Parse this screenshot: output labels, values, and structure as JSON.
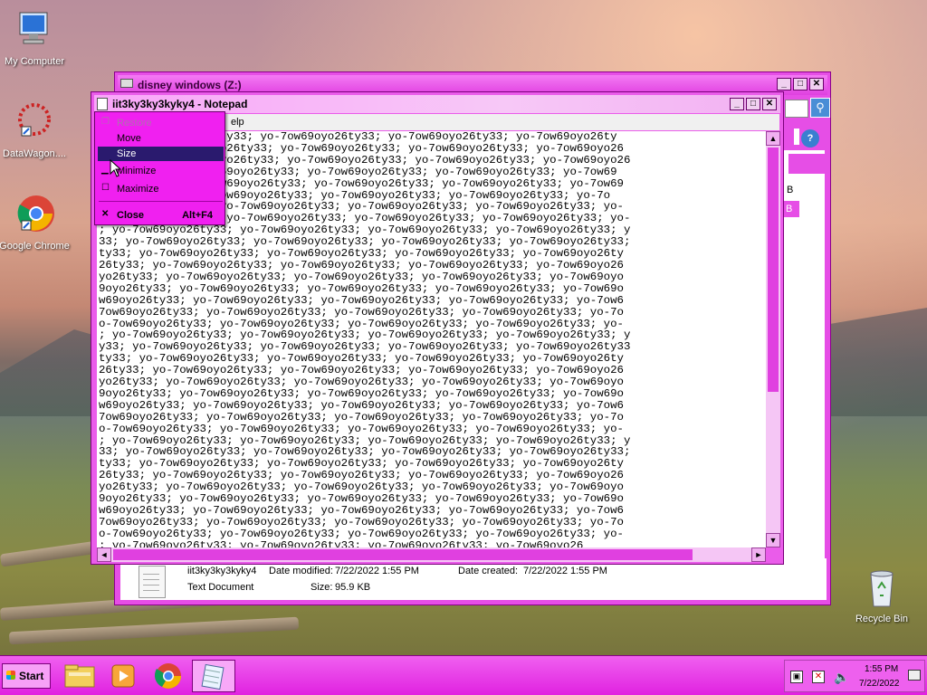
{
  "desktop": {
    "icons": [
      {
        "label": "My Computer",
        "icon": "computer-icon"
      },
      {
        "label": "DataWagon....",
        "icon": "datawagon-shortcut-icon"
      },
      {
        "label": "Google Chrome",
        "icon": "chrome-shortcut-icon"
      },
      {
        "label": "Recycle Bin",
        "icon": "recycle-bin-icon"
      }
    ]
  },
  "explorer": {
    "title": "disney windows (Z:)",
    "details": {
      "name": "iit3ky3ky3kyky4",
      "modified_label": "Date modified:",
      "modified_value": "7/22/2022 1:55 PM",
      "created_label": "Date created:",
      "created_value": "7/22/2022 1:55 PM",
      "type": "Text Document",
      "size_label": "Size:",
      "size_value": "95.9 KB"
    },
    "partial_b1": "B",
    "partial_b2": "B"
  },
  "notepad": {
    "title": "iit3ky3ky3kyky4 - Notepad",
    "menu_partial": "elp",
    "last_line": "; yo-7ow69oyo26ty33; yo-7ow69oyo26ty33; yo-7ow69oyo26ty33; yo-7ow69oyo26",
    "lines": [
      "y33; yo-7ow69oyo26ty33; yo-7ow69oyo26ty33; yo-7ow69oyo26ty33; yo-7ow69oyo26ty",
      "26ty33; yo-7ow69oyo26ty33; yo-7ow69oyo26ty33; yo-7ow69oyo26ty33; yo-7ow69oyo26",
      "o26ty33; yo-7ow69oyo26ty33; yo-7ow69oyo26ty33; yo-7ow69oyo26ty33; yo-7ow69oyo26",
      "9oyo26ty33; yo-7ow69oyo26ty33; yo-7ow69oyo26ty33; yo-7ow69oyo26ty33; yo-7ow69",
      "69oyo26ty33; yo-7ow69oyo26ty33; yo-7ow69oyo26ty33; yo-7ow69oyo26ty33; yo-7ow69",
      "w69oyo26ty33; yo-7ow69oyo26ty33; yo-7ow69oyo26ty33; yo-7ow69oyo26ty33; yo-7o",
      "o-7ow69oyo26ty33; yo-7ow69oyo26ty33; yo-7ow69oyo26ty33; yo-7ow69oyo26ty33; yo-",
      "yo-7ow69oyo26ty33; yo-7ow69oyo26ty33; yo-7ow69oyo26ty33; yo-7ow69oyo26ty33; yo-",
      "; yo-7ow69oyo26ty33; yo-7ow69oyo26ty33; yo-7ow69oyo26ty33; yo-7ow69oyo26ty33; y",
      "33; yo-7ow69oyo26ty33; yo-7ow69oyo26ty33; yo-7ow69oyo26ty33; yo-7ow69oyo26ty33;",
      "ty33; yo-7ow69oyo26ty33; yo-7ow69oyo26ty33; yo-7ow69oyo26ty33; yo-7ow69oyo26ty",
      "26ty33; yo-7ow69oyo26ty33; yo-7ow69oyo26ty33; yo-7ow69oyo26ty33; yo-7ow69oyo26",
      "yo26ty33; yo-7ow69oyo26ty33; yo-7ow69oyo26ty33; yo-7ow69oyo26ty33; yo-7ow69oyo",
      "9oyo26ty33; yo-7ow69oyo26ty33; yo-7ow69oyo26ty33; yo-7ow69oyo26ty33; yo-7ow69o",
      "w69oyo26ty33; yo-7ow69oyo26ty33; yo-7ow69oyo26ty33; yo-7ow69oyo26ty33; yo-7ow6",
      "7ow69oyo26ty33; yo-7ow69oyo26ty33; yo-7ow69oyo26ty33; yo-7ow69oyo26ty33; yo-7o",
      "o-7ow69oyo26ty33; yo-7ow69oyo26ty33; yo-7ow69oyo26ty33; yo-7ow69oyo26ty33; yo-",
      "; yo-7ow69oyo26ty33; yo-7ow69oyo26ty33; yo-7ow69oyo26ty33; yo-7ow69oyo26ty33; y",
      "y33; yo-7ow69oyo26ty33; yo-7ow69oyo26ty33; yo-7ow69oyo26ty33; yo-7ow69oyo26ty33",
      "ty33; yo-7ow69oyo26ty33; yo-7ow69oyo26ty33; yo-7ow69oyo26ty33; yo-7ow69oyo26ty",
      "26ty33; yo-7ow69oyo26ty33; yo-7ow69oyo26ty33; yo-7ow69oyo26ty33; yo-7ow69oyo26",
      "yo26ty33; yo-7ow69oyo26ty33; yo-7ow69oyo26ty33; yo-7ow69oyo26ty33; yo-7ow69oyo",
      "9oyo26ty33; yo-7ow69oyo26ty33; yo-7ow69oyo26ty33; yo-7ow69oyo26ty33; yo-7ow69o",
      "w69oyo26ty33; yo-7ow69oyo26ty33; yo-7ow69oyo26ty33; yo-7ow69oyo26ty33; yo-7ow6",
      "7ow69oyo26ty33; yo-7ow69oyo26ty33; yo-7ow69oyo26ty33; yo-7ow69oyo26ty33; yo-7o",
      "o-7ow69oyo26ty33; yo-7ow69oyo26ty33; yo-7ow69oyo26ty33; yo-7ow69oyo26ty33; yo-",
      "; yo-7ow69oyo26ty33; yo-7ow69oyo26ty33; yo-7ow69oyo26ty33; yo-7ow69oyo26ty33; y",
      "33; yo-7ow69oyo26ty33; yo-7ow69oyo26ty33; yo-7ow69oyo26ty33; yo-7ow69oyo26ty33;",
      "ty33; yo-7ow69oyo26ty33; yo-7ow69oyo26ty33; yo-7ow69oyo26ty33; yo-7ow69oyo26ty",
      "26ty33; yo-7ow69oyo26ty33; yo-7ow69oyo26ty33; yo-7ow69oyo26ty33; yo-7ow69oyo26",
      "yo26ty33; yo-7ow69oyo26ty33; yo-7ow69oyo26ty33; yo-7ow69oyo26ty33; yo-7ow69oyo",
      "9oyo26ty33; yo-7ow69oyo26ty33; yo-7ow69oyo26ty33; yo-7ow69oyo26ty33; yo-7ow69o",
      "w69oyo26ty33; yo-7ow69oyo26ty33; yo-7ow69oyo26ty33; yo-7ow69oyo26ty33; yo-7ow6",
      "7ow69oyo26ty33; yo-7ow69oyo26ty33; yo-7ow69oyo26ty33; yo-7ow69oyo26ty33; yo-7o",
      "o-7ow69oyo26ty33; yo-7ow69oyo26ty33; yo-7ow69oyo26ty33; yo-7ow69oyo26ty33; yo-"
    ]
  },
  "system_menu": {
    "items": [
      {
        "label": "Restore",
        "glyph": "restore-icon",
        "state": "disabled"
      },
      {
        "label": "Move",
        "glyph": "",
        "state": "normal"
      },
      {
        "label": "Size",
        "glyph": "",
        "state": "highlighted"
      },
      {
        "label": "Minimize",
        "glyph": "minimize-icon",
        "state": "normal"
      },
      {
        "label": "Maximize",
        "glyph": "maximize-icon",
        "state": "normal"
      },
      {
        "label": "Close",
        "glyph": "close-icon",
        "state": "normal",
        "shortcut": "Alt+F4"
      }
    ]
  },
  "taskbar": {
    "start_label": "Start",
    "buttons": [
      "explorer-icon",
      "media-player-icon",
      "chrome-icon",
      "notepad-icon"
    ],
    "clock_time": "1:55 PM",
    "clock_date": "7/22/2022"
  },
  "colors": {
    "theme": "#e64ee6",
    "menu_highlight": "#2a1a6e"
  }
}
